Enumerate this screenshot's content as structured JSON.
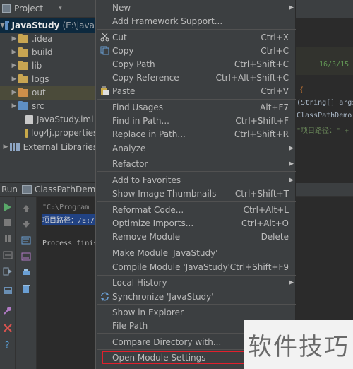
{
  "project_panel": {
    "title": "Project",
    "dropdown_glyph": "▾",
    "tree": [
      {
        "kind": "root",
        "label": "JavaStudy",
        "path": "(E:\\java\\",
        "arrow": "▼",
        "icon": "module-folder-icon"
      },
      {
        "kind": "folder",
        "label": ".idea",
        "arrow": "▶",
        "icon": "folder-icon"
      },
      {
        "kind": "folder",
        "label": "build",
        "arrow": "▶",
        "icon": "folder-icon"
      },
      {
        "kind": "folder",
        "label": "lib",
        "arrow": "▶",
        "icon": "folder-icon"
      },
      {
        "kind": "folder",
        "label": "logs",
        "arrow": "▶",
        "icon": "folder-icon"
      },
      {
        "kind": "folder",
        "label": "out",
        "arrow": "▶",
        "icon": "excluded-folder-icon"
      },
      {
        "kind": "folder",
        "label": "src",
        "arrow": "▶",
        "icon": "source-folder-icon"
      },
      {
        "kind": "file",
        "label": "JavaStudy.iml",
        "arrow": "",
        "icon": "iml-file-icon"
      },
      {
        "kind": "file",
        "label": "log4j.properties",
        "arrow": "",
        "icon": "properties-file-icon"
      },
      {
        "kind": "libs",
        "label": "External Libraries",
        "arrow": "▶",
        "icon": "external-libraries-icon"
      }
    ]
  },
  "editor": {
    "date_text": "16/3/15",
    "code_lines": [
      "{",
      "(String[] args",
      "ClassPathDemo.",
      "\"项目路径：\" +"
    ]
  },
  "run_panel": {
    "label": "Run",
    "config_name": "ClassPathDemo",
    "console_lines": [
      "\"C:\\Program ...",
      "项目路径：/E:/",
      "Process finish"
    ]
  },
  "context_menu": {
    "items": [
      {
        "label": "New",
        "shortcut": "",
        "submenu": true,
        "icon": ""
      },
      {
        "label": "Add Framework Support...",
        "shortcut": "",
        "submenu": false,
        "icon": ""
      },
      {
        "label": "Cut",
        "shortcut": "Ctrl+X",
        "submenu": false,
        "icon": "scissors-icon"
      },
      {
        "label": "Copy",
        "shortcut": "Ctrl+C",
        "submenu": false,
        "icon": "copy-icon"
      },
      {
        "label": "Copy Path",
        "shortcut": "Ctrl+Shift+C",
        "submenu": false,
        "icon": ""
      },
      {
        "label": "Copy Reference",
        "shortcut": "Ctrl+Alt+Shift+C",
        "submenu": false,
        "icon": ""
      },
      {
        "label": "Paste",
        "shortcut": "Ctrl+V",
        "submenu": false,
        "icon": "paste-icon"
      },
      {
        "label": "Find Usages",
        "shortcut": "Alt+F7",
        "submenu": false,
        "icon": ""
      },
      {
        "label": "Find in Path...",
        "shortcut": "Ctrl+Shift+F",
        "submenu": false,
        "icon": ""
      },
      {
        "label": "Replace in Path...",
        "shortcut": "Ctrl+Shift+R",
        "submenu": false,
        "icon": ""
      },
      {
        "label": "Analyze",
        "shortcut": "",
        "submenu": true,
        "icon": ""
      },
      {
        "label": "Refactor",
        "shortcut": "",
        "submenu": true,
        "icon": ""
      },
      {
        "label": "Add to Favorites",
        "shortcut": "",
        "submenu": true,
        "icon": ""
      },
      {
        "label": "Show Image Thumbnails",
        "shortcut": "Ctrl+Shift+T",
        "submenu": false,
        "icon": ""
      },
      {
        "label": "Reformat Code...",
        "shortcut": "Ctrl+Alt+L",
        "submenu": false,
        "icon": ""
      },
      {
        "label": "Optimize Imports...",
        "shortcut": "Ctrl+Alt+O",
        "submenu": false,
        "icon": ""
      },
      {
        "label": "Remove Module",
        "shortcut": "Delete",
        "submenu": false,
        "icon": ""
      },
      {
        "label": "Make Module 'JavaStudy'",
        "shortcut": "",
        "submenu": false,
        "icon": ""
      },
      {
        "label": "Compile Module 'JavaStudy'",
        "shortcut": "Ctrl+Shift+F9",
        "submenu": false,
        "icon": ""
      },
      {
        "label": "Local History",
        "shortcut": "",
        "submenu": true,
        "icon": ""
      },
      {
        "label": "Synchronize 'JavaStudy'",
        "shortcut": "",
        "submenu": false,
        "icon": "sync-icon"
      },
      {
        "label": "Show in Explorer",
        "shortcut": "",
        "submenu": false,
        "icon": ""
      },
      {
        "label": "File Path",
        "shortcut": "C",
        "submenu": false,
        "icon": ""
      },
      {
        "label": "Compare Directory with...",
        "shortcut": "",
        "submenu": false,
        "icon": ""
      },
      {
        "label": "Open Module Settings",
        "shortcut": "",
        "submenu": false,
        "icon": "",
        "highlighted": true
      }
    ]
  },
  "watermark": {
    "text": "软件技巧"
  },
  "colors": {
    "highlight_border": "#e0202d",
    "menu_bg": "#3c3f41",
    "selection_bg": "#0d293e"
  }
}
